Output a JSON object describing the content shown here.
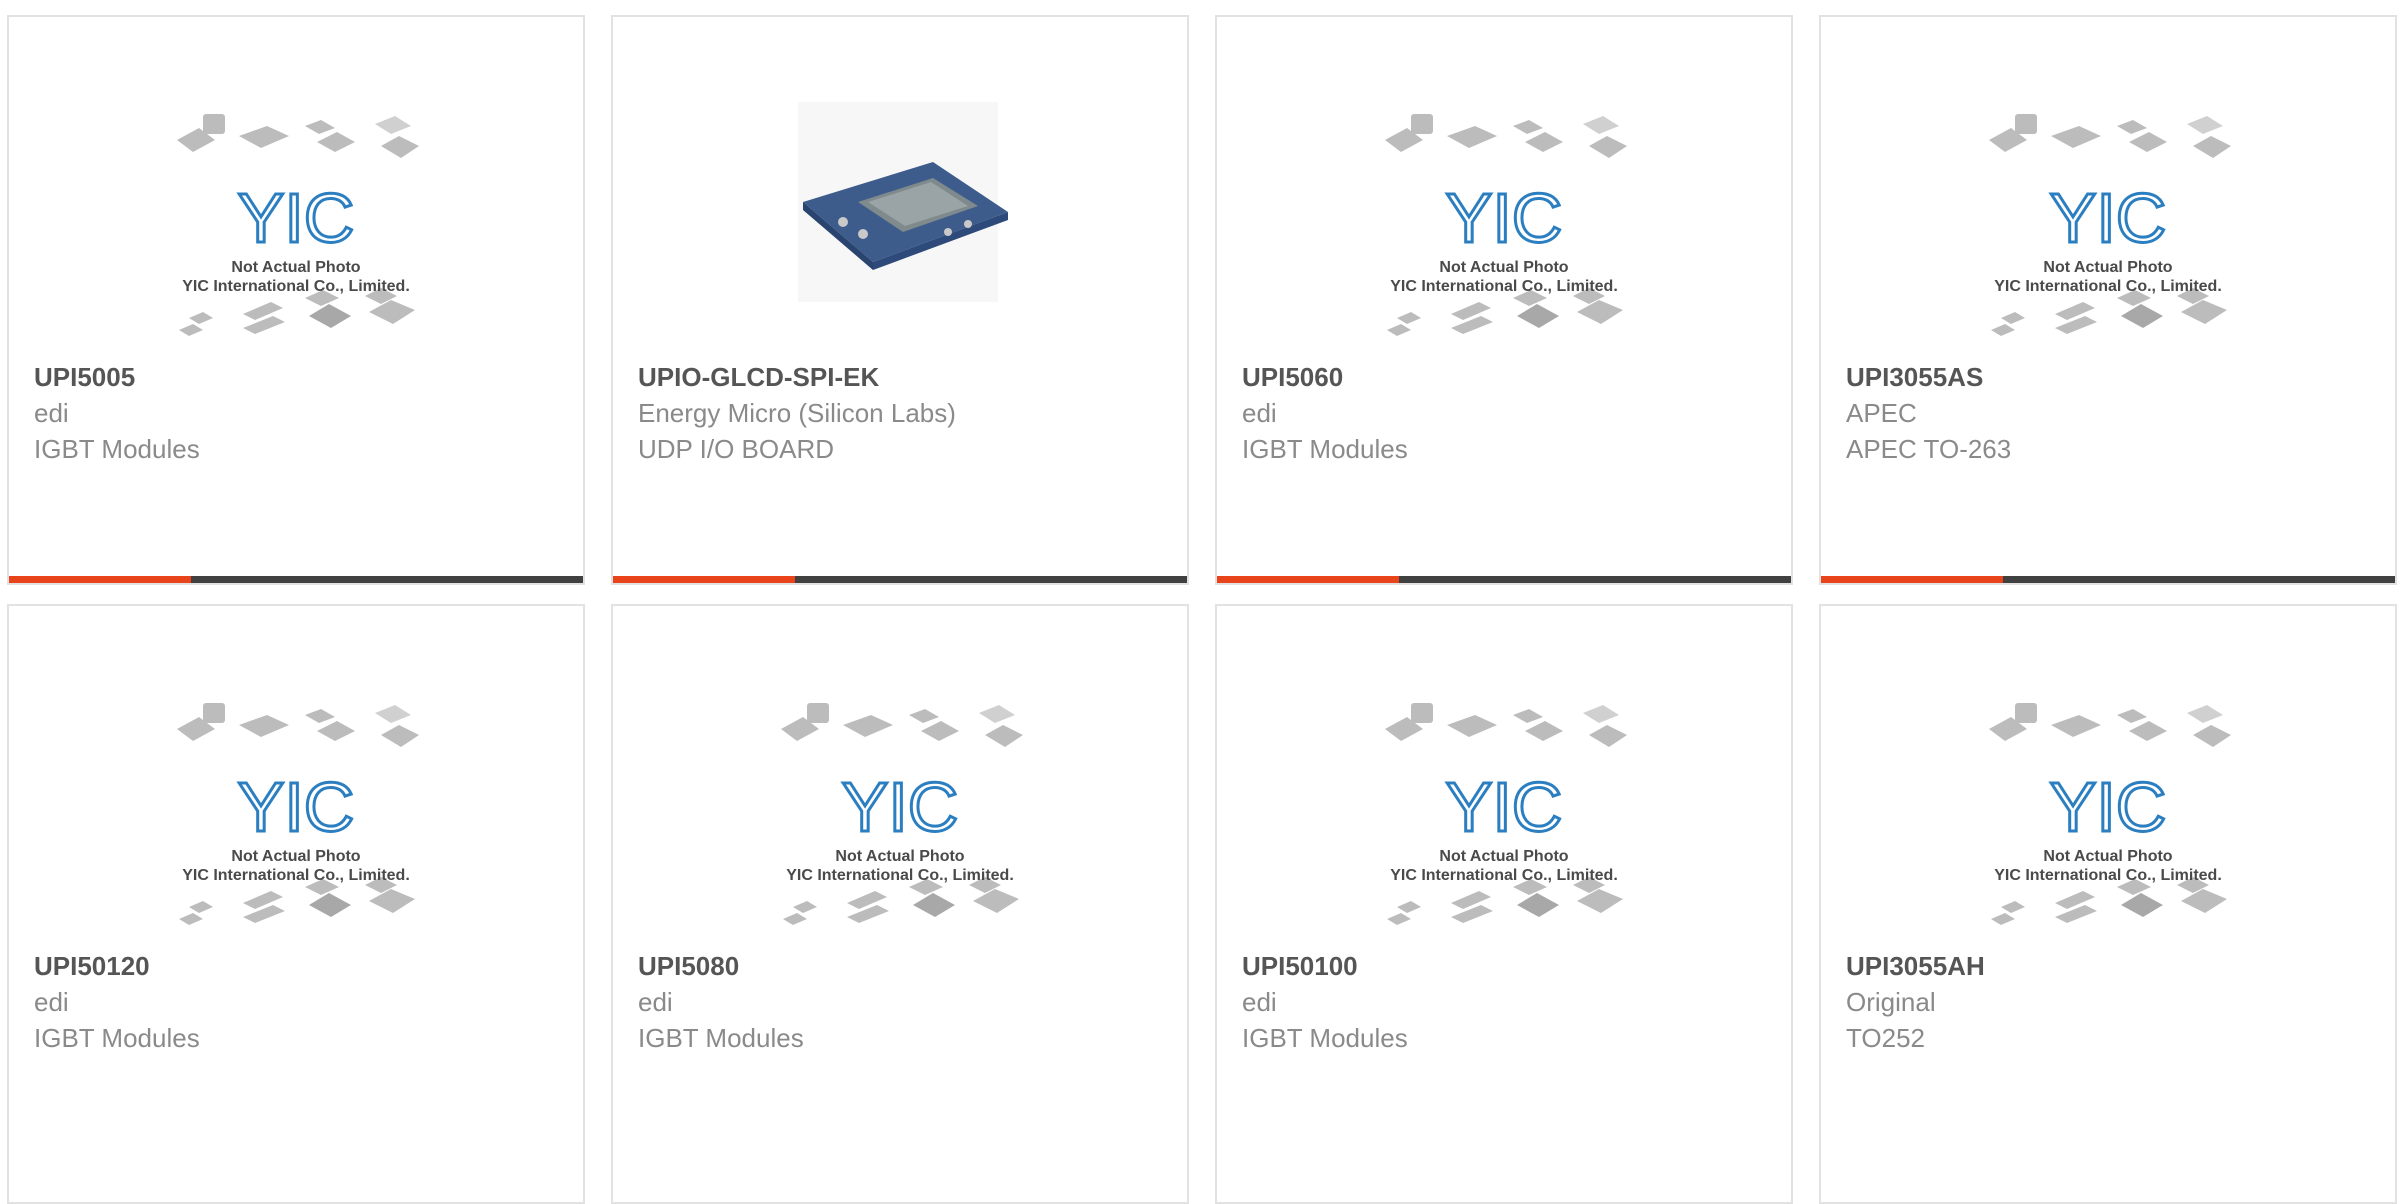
{
  "placeholder": {
    "line1": "Not Actual Photo",
    "line2": "YIC International Co., Limited."
  },
  "colors": {
    "accent": "#e8431b",
    "bar": "#404040",
    "logo": "#2b7fc1",
    "chip": "#b8b8b8"
  },
  "products": [
    {
      "part": "UPI5005",
      "maker": "edi",
      "desc": "IGBT Modules",
      "image": "placeholder"
    },
    {
      "part": "UPIO-GLCD-SPI-EK",
      "maker": "Energy Micro (Silicon Labs)",
      "desc": "UDP I/O BOARD",
      "image": "board-photo"
    },
    {
      "part": "UPI5060",
      "maker": "edi",
      "desc": "IGBT Modules",
      "image": "placeholder"
    },
    {
      "part": "UPI3055AS",
      "maker": "APEC",
      "desc": "APEC TO-263",
      "image": "placeholder"
    },
    {
      "part": "UPI50120",
      "maker": "edi",
      "desc": "IGBT Modules",
      "image": "placeholder"
    },
    {
      "part": "UPI5080",
      "maker": "edi",
      "desc": "IGBT Modules",
      "image": "placeholder"
    },
    {
      "part": "UPI50100",
      "maker": "edi",
      "desc": "IGBT Modules",
      "image": "placeholder"
    },
    {
      "part": "UPI3055AH",
      "maker": "Original",
      "desc": "TO252",
      "image": "placeholder"
    }
  ]
}
